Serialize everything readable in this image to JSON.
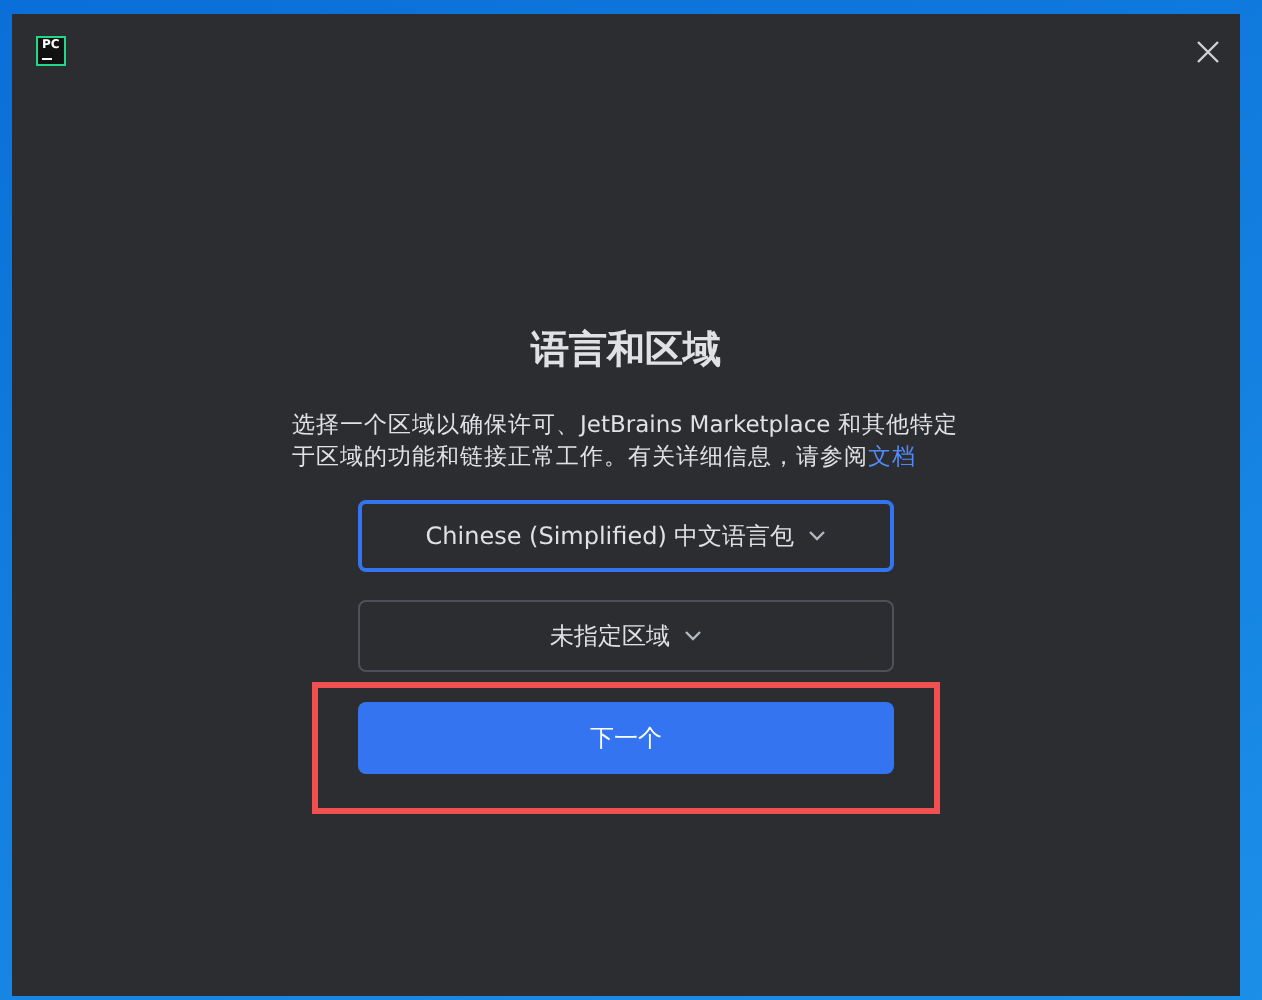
{
  "window": {
    "logo": "PC",
    "title": "语言和区域"
  },
  "description": {
    "text": "选择一个区域以确保许可、JetBrains Marketplace 和其他特定于区域的功能和链接正常工作。有关详细信息，请参阅",
    "link": "文档"
  },
  "dropdowns": [
    {
      "value": "Chinese (Simplified) 中文语言包",
      "focused": true
    },
    {
      "value": "未指定区域",
      "focused": false
    }
  ],
  "next_button": {
    "label": "下一个",
    "highlighted": true
  }
}
